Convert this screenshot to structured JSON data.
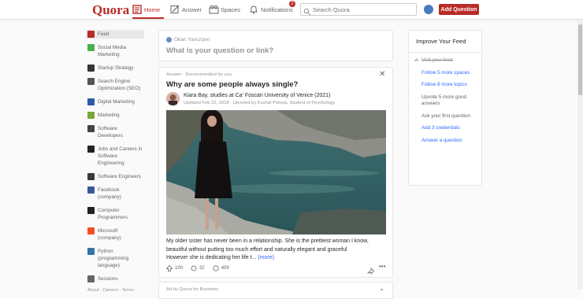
{
  "header": {
    "logo": "Quora",
    "nav": {
      "home": "Home",
      "answer": "Answer",
      "spaces": "Spaces",
      "notifications": "Notifications",
      "notifications_count": "2"
    },
    "search_placeholder": "Search Quora",
    "add_question": "Add Question",
    "accent": "#b92b27"
  },
  "sidebar": {
    "items": [
      {
        "label": "Feed",
        "icon": "feed-icon",
        "color": "#b92b27"
      },
      {
        "label": "Social Media Marketing",
        "icon": "social-media-icon",
        "color": "#4caf50"
      },
      {
        "label": "Startup Strategy",
        "icon": "startup-icon",
        "color": "#333333"
      },
      {
        "label": "Search Engine Optimization (SEO)",
        "icon": "seo-icon",
        "color": "#555555"
      },
      {
        "label": "Digital Marketing",
        "icon": "digital-marketing-icon",
        "color": "#2b5aa8"
      },
      {
        "label": "Marketing",
        "icon": "marketing-icon",
        "color": "#7aa53a"
      },
      {
        "label": "Software Developers",
        "icon": "software-developers-icon",
        "color": "#444444"
      },
      {
        "label": "Jobs and Careers in Software Engineering",
        "icon": "jobs-icon",
        "color": "#222222"
      },
      {
        "label": "Software Engineers",
        "icon": "software-engineers-icon",
        "color": "#3a3a3a"
      },
      {
        "label": "Facebook (company)",
        "icon": "facebook-icon",
        "color": "#3b5998"
      },
      {
        "label": "Computer Programmers",
        "icon": "programmers-icon",
        "color": "#222222"
      },
      {
        "label": "Microsoft (company)",
        "icon": "microsoft-icon",
        "color": "#f25022"
      },
      {
        "label": "Python (programming language)",
        "icon": "python-icon",
        "color": "#3572a5"
      },
      {
        "label": "Sessions",
        "icon": "sessions-icon",
        "color": "#666666"
      }
    ],
    "footer": "About · Careers · Terms ·"
  },
  "ask": {
    "user": "Okan Yavuzşen",
    "prompt": "What is your question or link?"
  },
  "answer": {
    "meta": "Answer · Recommended for you",
    "question": "Why are some people always single?",
    "author": "Kiara Bay, studies at Ca' Foscari University of Venice (2021)",
    "updated": "Updated Feb 22, 2018 · Upvoted by Kushal Pahuja, Student of Psychology",
    "body_lines": [
      "My older sister has never been in a relationship. She is the prettiest woman I know,",
      "beautiful without putting too much effort and naturally elegant and graceful",
      "However she is dedicating her life t..."
    ],
    "more": "(more)",
    "upvotes": "100",
    "shares": "32",
    "comments": "409"
  },
  "ad": {
    "label": "Ad by Quora for Business"
  },
  "improve": {
    "title": "Improve Your Feed",
    "items": [
      {
        "label": "Visit your feed",
        "state": "done"
      },
      {
        "label": "Follow 5 more spaces",
        "state": "link"
      },
      {
        "label": "Follow 8 more topics",
        "state": "link"
      },
      {
        "label": "Upvote 5 more good answers",
        "state": "dark"
      },
      {
        "label": "Ask your first question",
        "state": "dark"
      },
      {
        "label": "Add 3 credentials",
        "state": "link"
      },
      {
        "label": "Answer a question",
        "state": "link"
      }
    ]
  }
}
